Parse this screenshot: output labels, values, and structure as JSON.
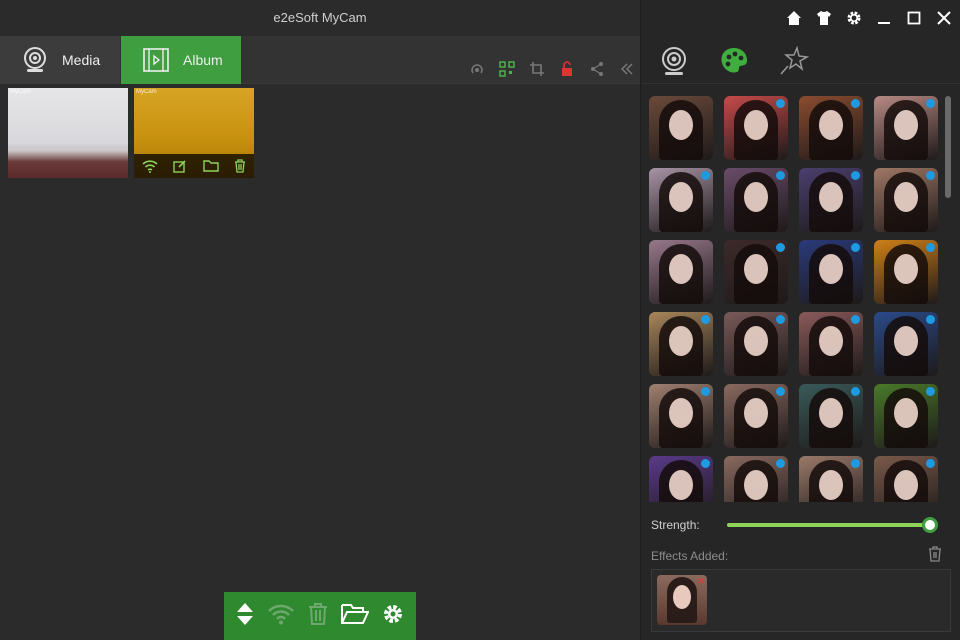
{
  "window": {
    "title": "e2eSoft MyCam"
  },
  "tabs": [
    {
      "label": "Media",
      "icon": "webcam-icon"
    },
    {
      "label": "Album",
      "icon": "film-icon"
    }
  ],
  "toolbar": {
    "icons": [
      "broadcast-icon",
      "qr-code-icon",
      "crop-icon",
      "unlock-icon",
      "share-icon",
      "collapse-icon"
    ]
  },
  "thumbnails": [
    {
      "watermark": "MyCam"
    },
    {
      "watermark": "MyCam",
      "actions": [
        "wifi-icon",
        "edit-icon",
        "folder-icon",
        "trash-icon"
      ]
    }
  ],
  "dock": {
    "icons": [
      "sort-icon",
      "wifi-icon",
      "trash-icon",
      "folder-open-icon",
      "gear-icon"
    ]
  },
  "window_controls": [
    "home-icon",
    "tshirt-icon",
    "gear-icon",
    "minimize-icon",
    "maximize-icon",
    "close-icon"
  ],
  "right_tabs": [
    "camera-icon",
    "palette-icon",
    "sparkle-icon"
  ],
  "effects": {
    "rows": 6,
    "cols": 4,
    "tints": [
      "#6b4a3a",
      "#c64a4a",
      "#8a4c2f",
      "#b88a84",
      "#a894a6",
      "#6a4c6a",
      "#4b3f6e",
      "#a07866",
      "#98788c",
      "#3e2a2a",
      "#2a3a7a",
      "#d08018",
      "#a8865a",
      "#7a5a5a",
      "#8a5a5a",
      "#2a4a8a",
      "#a08070",
      "#8a6a60",
      "#3a5a5a",
      "#4a7a2a",
      "#5a3a8a",
      "#8a6a60",
      "#9a7a6a",
      "#7a5a4a"
    ],
    "dots": [
      false,
      true,
      true,
      true,
      true,
      true,
      true,
      true,
      false,
      true,
      true,
      true,
      true,
      true,
      true,
      true,
      true,
      true,
      true,
      true,
      true,
      true,
      true,
      true
    ]
  },
  "strength": {
    "label": "Strength:",
    "value": 1.0
  },
  "effects_added": {
    "label": "Effects Added:"
  },
  "colors": {
    "accent": "#3f9e3f",
    "dot": "#1e9be0",
    "slider": "#8ed25a"
  }
}
